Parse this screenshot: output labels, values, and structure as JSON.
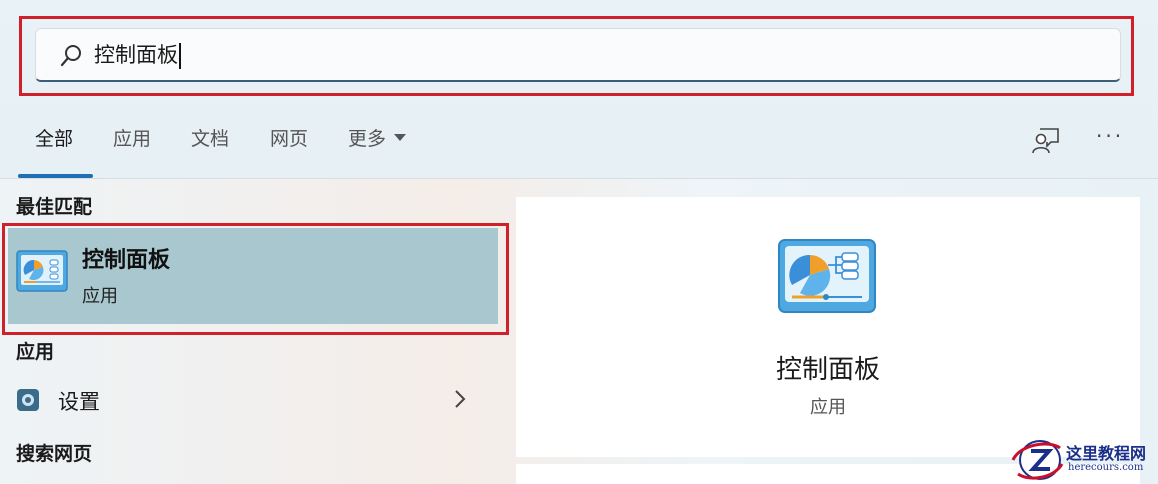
{
  "search": {
    "value": "控制面板"
  },
  "tabs": [
    {
      "label": "全部",
      "active": true
    },
    {
      "label": "应用"
    },
    {
      "label": "文档"
    },
    {
      "label": "网页"
    },
    {
      "label": "更多"
    }
  ],
  "toolbar": {
    "more_label": "···"
  },
  "best_match": {
    "heading": "最佳匹配",
    "title": "控制面板",
    "subtitle": "应用"
  },
  "apps": {
    "heading": "应用",
    "items": [
      {
        "label": "设置"
      }
    ]
  },
  "web": {
    "heading": "搜索网页"
  },
  "detail": {
    "title": "控制面板",
    "subtitle": "应用"
  },
  "watermark": {
    "title": "这里教程网",
    "url": "herecours.com"
  },
  "colors": {
    "highlight": "#d0202a",
    "accent": "#1f6fb5",
    "selected_bg": "#a9c7cf"
  }
}
